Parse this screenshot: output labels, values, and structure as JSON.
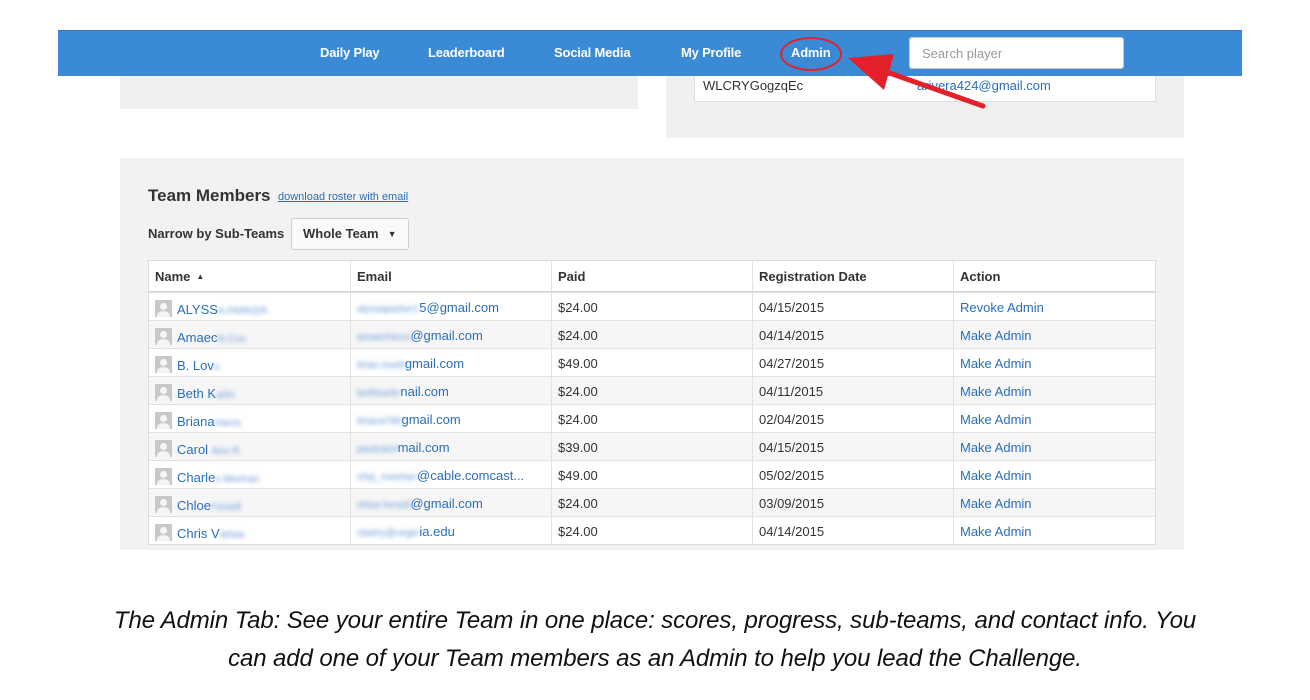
{
  "nav": {
    "links": [
      "Daily Play",
      "Leaderboard",
      "Social Media",
      "My Profile",
      "Admin"
    ],
    "search_placeholder": "Search player"
  },
  "code_panel": {
    "code": "WLCRYGogzqEc",
    "email_partial": "arivera424@gmail.com"
  },
  "team": {
    "title": "Team Members",
    "roster_link": "download roster with email",
    "narrow_label": "Narrow by Sub-Teams",
    "subteam_value": "Whole Team",
    "columns": [
      "Name",
      "Email",
      "Paid",
      "Registration Date",
      "Action"
    ],
    "sort_indicator": "▲",
    "rows": [
      {
        "name": "ALYSS",
        "name_blur": "A PARKER",
        "email_blur": "alyssaparker1",
        "email": "5@gmail.com",
        "paid": "$24.00",
        "date": "04/15/2015",
        "action": "Revoke Admin"
      },
      {
        "name": "Amaec",
        "name_blur": "hi Cox",
        "email_blur": "amaechicox",
        "email": "@gmail.com",
        "paid": "$24.00",
        "date": "04/14/2015",
        "action": "Make Admin"
      },
      {
        "name": "B. Lov",
        "name_blur": "e",
        "email_blur": "brian.lovell",
        "email": "gmail.com",
        "paid": "$49.00",
        "date": "04/27/2015",
        "action": "Make Admin"
      },
      {
        "name": "Beth K",
        "name_blur": "arlin",
        "email_blur": "bethkarlin",
        "email": "nail.com",
        "paid": "$24.00",
        "date": "04/11/2015",
        "action": "Make Admin"
      },
      {
        "name": "Briana",
        "name_blur": "Harris",
        "email_blur": "briana786",
        "email": "gmail.com",
        "paid": "$24.00",
        "date": "02/04/2015",
        "action": "Make Admin"
      },
      {
        "name": "Carol ",
        "name_blur": "Ann R.",
        "email_blur": "paulcarol",
        "email": "mail.com",
        "paid": "$39.00",
        "date": "04/15/2015",
        "action": "Make Admin"
      },
      {
        "name": "Charle",
        "name_blur": "s Meehan",
        "email_blur": "chip_meehan",
        "email": "@cable.comcast...",
        "paid": "$49.00",
        "date": "05/02/2015",
        "action": "Make Admin"
      },
      {
        "name": "Chloe",
        "name_blur": "Forsell",
        "email_blur": "chloe.forsell",
        "email": "@gmail.com",
        "paid": "$24.00",
        "date": "03/09/2015",
        "action": "Make Admin"
      },
      {
        "name": "Chris V",
        "name_blur": "White",
        "email_blur": "cbwhy@virgin",
        "email": "ia.edu",
        "paid": "$24.00",
        "date": "04/14/2015",
        "action": "Make Admin"
      }
    ]
  },
  "caption": [
    "The Admin Tab: See your entire Team in one place: scores, progress, sub-teams, and contact info.  You",
    "can add one of your Team members as an Admin to help you lead the Challenge."
  ],
  "colors": {
    "navbar": "#3a8ad6",
    "link": "#2a6ebb",
    "highlight": "#e4202a",
    "panel": "#f2f2f2"
  }
}
